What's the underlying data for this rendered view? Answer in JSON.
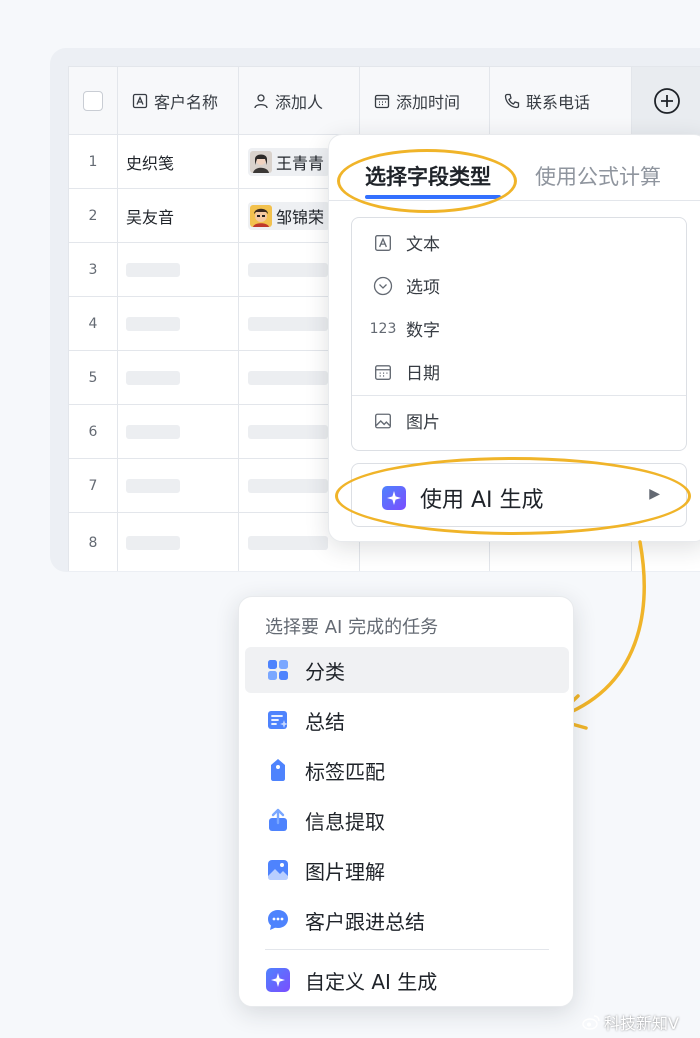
{
  "table": {
    "headers": {
      "customer_name": "客户名称",
      "adder": "添加人",
      "add_time": "添加时间",
      "phone": "联系电话"
    },
    "rows": [
      {
        "num": "1",
        "name": "史织笺",
        "adder": "王青青"
      },
      {
        "num": "2",
        "name": "吴友音",
        "adder": "邹锦荣"
      },
      {
        "num": "3"
      },
      {
        "num": "4"
      },
      {
        "num": "5"
      },
      {
        "num": "6"
      },
      {
        "num": "7"
      },
      {
        "num": "8"
      }
    ]
  },
  "field_menu": {
    "tab_active": "选择字段类型",
    "tab_inactive": "使用公式计算",
    "types": [
      {
        "icon": "text-type-icon",
        "glyph": "A",
        "label": "文本"
      },
      {
        "icon": "option-type-icon",
        "label": "选项"
      },
      {
        "icon": "number-type-icon",
        "glyph": "123",
        "label": "数字"
      },
      {
        "icon": "date-type-icon",
        "label": "日期"
      },
      {
        "icon": "image-type-icon",
        "label": "图片"
      }
    ],
    "ai_label": "使用 AI 生成",
    "accent": "#3370ff",
    "highlight_color": "#f0b429"
  },
  "task_menu": {
    "title": "选择要 AI 完成的任务",
    "items": [
      {
        "icon": "category-icon",
        "label": "分类"
      },
      {
        "icon": "summary-icon",
        "label": "总结"
      },
      {
        "icon": "tag-match-icon",
        "label": "标签匹配"
      },
      {
        "icon": "info-extract-icon",
        "label": "信息提取"
      },
      {
        "icon": "image-understand-icon",
        "label": "图片理解"
      },
      {
        "icon": "customer-followup-icon",
        "label": "客户跟进总结"
      }
    ],
    "custom_label": "自定义 AI 生成"
  },
  "watermark": "科技新知V"
}
